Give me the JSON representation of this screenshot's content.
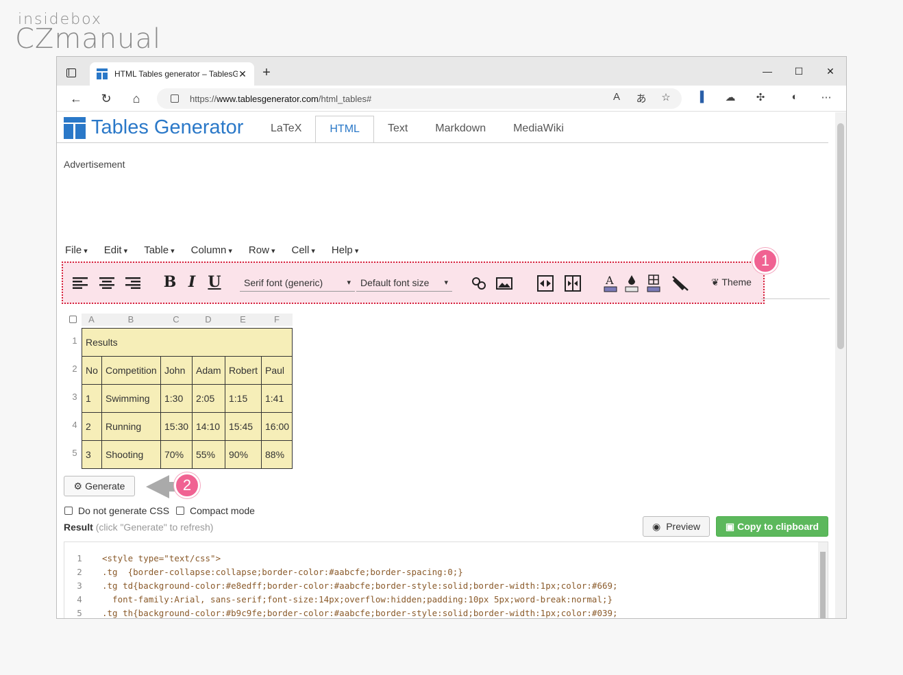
{
  "watermark": {
    "line1": "insidebox",
    "line2": "CZmanual"
  },
  "browser": {
    "tab_title": "HTML Tables generator – TablesG",
    "url_prefix": "https://",
    "url_host": "www.tablesgenerator.com",
    "url_path": "/html_tables#",
    "new_tab": "+",
    "close_tab": "✕"
  },
  "site": {
    "name": "Tables Generator",
    "tabs": [
      "LaTeX",
      "HTML",
      "Text",
      "Markdown",
      "MediaWiki"
    ],
    "active_tab": "HTML",
    "advertisement": "Advertisement"
  },
  "menu": [
    "File",
    "Edit",
    "Table",
    "Column",
    "Row",
    "Cell",
    "Help"
  ],
  "toolbar": {
    "bold": "B",
    "italic": "I",
    "underline": "U",
    "font_family": "Serif font (generic)",
    "font_size": "Default font size",
    "theme": "Theme"
  },
  "badges": {
    "one": "1",
    "two": "2"
  },
  "grid": {
    "columns": [
      "A",
      "B",
      "C",
      "D",
      "E",
      "F"
    ],
    "row_numbers": [
      "1",
      "2",
      "3",
      "4",
      "5"
    ],
    "title": "Results",
    "rows": [
      [
        "No",
        "Competition",
        "John",
        "Adam",
        "Robert",
        "Paul"
      ],
      [
        "1",
        "Swimming",
        "1:30",
        "2:05",
        "1:15",
        "1:41"
      ],
      [
        "2",
        "Running",
        "15:30",
        "14:10",
        "15:45",
        "16:00"
      ],
      [
        "3",
        "Shooting",
        "70%",
        "55%",
        "90%",
        "88%"
      ]
    ]
  },
  "controls": {
    "generate": "Generate",
    "no_css": "Do not generate CSS",
    "compact": "Compact mode",
    "result_label": "Result",
    "result_hint": "(click \"Generate\" to refresh)",
    "preview": "Preview",
    "copy": "Copy to clipboard"
  },
  "code": {
    "line_numbers": [
      "1",
      "2",
      "3",
      "4",
      "5"
    ],
    "lines": [
      "<style type=\"text/css\">",
      ".tg  {border-collapse:collapse;border-color:#aabcfe;border-spacing:0;}",
      ".tg td{background-color:#e8edff;border-color:#aabcfe;border-style:solid;border-width:1px;color:#669;",
      "  font-family:Arial, sans-serif;font-size:14px;overflow:hidden;padding:10px 5px;word-break:normal;}",
      ".tg th{background-color:#b9c9fe;border-color:#aabcfe;border-style:solid;border-width:1px;color:#039;"
    ]
  }
}
